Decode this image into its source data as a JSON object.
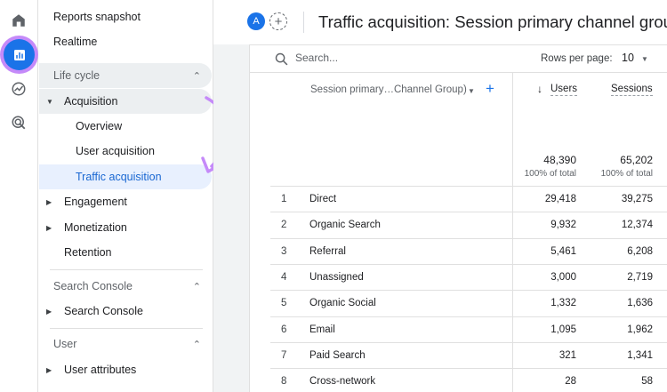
{
  "rail": {
    "icons": [
      "home-icon",
      "reports-icon",
      "explore-icon",
      "advertising-icon"
    ],
    "active_color": "#1a73e8",
    "highlight_color": "#c58af9"
  },
  "sidebar": {
    "reports_snapshot": "Reports snapshot",
    "realtime": "Realtime",
    "lifecycle": {
      "title": "Life cycle",
      "acquisition": "Acquisition",
      "overview": "Overview",
      "user_acquisition": "User acquisition",
      "traffic_acquisition": "Traffic acquisition",
      "engagement": "Engagement",
      "monetization": "Monetization",
      "retention": "Retention"
    },
    "search_console": {
      "title": "Search Console",
      "item": "Search Console"
    },
    "user": {
      "title": "User",
      "attributes": "User attributes"
    }
  },
  "header": {
    "avatar_letter": "A",
    "add_comparison": "+",
    "title": "Traffic acquisition: Session primary channel group"
  },
  "toolbar": {
    "search_placeholder": "Search...",
    "rows_label": "Rows per page:",
    "rows_value": "10"
  },
  "table": {
    "dimension_header": "Session primary…Channel Group)",
    "add_dimension": "+",
    "col_users": "Users",
    "col_sessions": "Sessions",
    "totals": {
      "users": "48,390",
      "users_pct": "100% of total",
      "sessions": "65,202",
      "sessions_pct": "100% of total"
    },
    "rows": [
      {
        "idx": "1",
        "name": "Direct",
        "users": "29,418",
        "sessions": "39,275"
      },
      {
        "idx": "2",
        "name": "Organic Search",
        "users": "9,932",
        "sessions": "12,374"
      },
      {
        "idx": "3",
        "name": "Referral",
        "users": "5,461",
        "sessions": "6,208"
      },
      {
        "idx": "4",
        "name": "Unassigned",
        "users": "3,000",
        "sessions": "2,719"
      },
      {
        "idx": "5",
        "name": "Organic Social",
        "users": "1,332",
        "sessions": "1,636"
      },
      {
        "idx": "6",
        "name": "Email",
        "users": "1,095",
        "sessions": "1,962"
      },
      {
        "idx": "7",
        "name": "Paid Search",
        "users": "321",
        "sessions": "1,341"
      },
      {
        "idx": "8",
        "name": "Cross-network",
        "users": "28",
        "sessions": "58"
      }
    ]
  }
}
